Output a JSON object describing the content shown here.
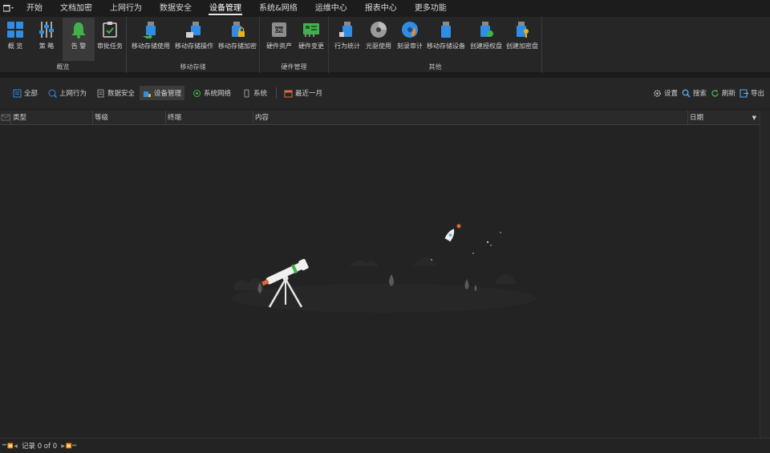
{
  "menubar": {
    "items": [
      "开始",
      "文档加密",
      "上网行为",
      "数据安全",
      "设备管理",
      "系统&网络",
      "运维中心",
      "报表中心",
      "更多功能"
    ],
    "active_index": 4
  },
  "ribbon": {
    "groups": [
      {
        "label": "概览",
        "buttons": [
          {
            "label": "概 览",
            "icon": "grid-icon"
          },
          {
            "label": "策 略",
            "icon": "sliders-icon"
          },
          {
            "label": "告 警",
            "icon": "bell-icon"
          },
          {
            "label": "审批任务",
            "icon": "checklist-icon"
          }
        ]
      },
      {
        "label": "移动存储",
        "buttons": [
          {
            "label": "移动存储使用",
            "icon": "usb-use-icon"
          },
          {
            "label": "移动存储操作",
            "icon": "usb-operate-icon"
          },
          {
            "label": "移动存储加密",
            "icon": "usb-lock-icon"
          }
        ]
      },
      {
        "label": "硬件管理",
        "buttons": [
          {
            "label": "硬件资产",
            "icon": "cpu-icon"
          },
          {
            "label": "硬件变更",
            "icon": "circuit-board-icon"
          }
        ]
      },
      {
        "label": "其他",
        "buttons": [
          {
            "label": "行为统计",
            "icon": "usb-stats-icon"
          },
          {
            "label": "光驱使用",
            "icon": "disc-icon"
          },
          {
            "label": "刻录审计",
            "icon": "disc-burn-icon"
          },
          {
            "label": "移动存储设备",
            "icon": "usb-device-icon"
          },
          {
            "label": "创建授权盘",
            "icon": "usb-authorize-icon"
          },
          {
            "label": "创建加密盘",
            "icon": "usb-key-icon"
          }
        ]
      }
    ],
    "accent": "#2f8de4",
    "alert_green": "#43b14b"
  },
  "toolbar": {
    "filters": [
      {
        "label": "全部",
        "icon": "list-icon"
      },
      {
        "label": "上网行为",
        "icon": "globe-search-icon"
      },
      {
        "label": "数据安全",
        "icon": "document-icon"
      },
      {
        "label": "设备管理",
        "icon": "device-icon"
      },
      {
        "label": "系统网络",
        "icon": "network-icon"
      },
      {
        "label": "系统",
        "icon": "phone-icon"
      }
    ],
    "active_index": 3,
    "period": "最近一月",
    "actions": [
      {
        "label": "设置",
        "icon": "gear-icon"
      },
      {
        "label": "搜索",
        "icon": "search-icon"
      },
      {
        "label": "刷新",
        "icon": "refresh-icon"
      },
      {
        "label": "导出",
        "icon": "export-icon"
      }
    ]
  },
  "table": {
    "columns": [
      "类型",
      "等级",
      "终端",
      "内容",
      "日期"
    ],
    "rows": []
  },
  "statusbar": {
    "records_text": "记录 0 of 0"
  }
}
